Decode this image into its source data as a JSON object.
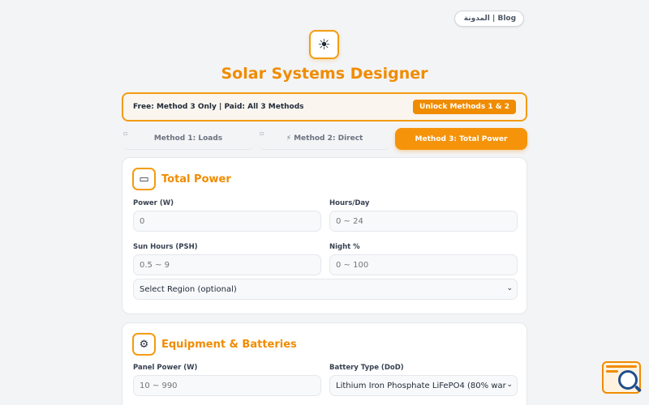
{
  "header": {
    "blog_link": " المدونة | Blog",
    "logo_icon": "sun-icon",
    "title": "Solar Systems Designer"
  },
  "promo": {
    "text": "Free: Method 3 Only | Paid: All 3 Methods",
    "button": "Unlock Methods 1 & 2"
  },
  "tabs": [
    {
      "label": "Method 1: Loads",
      "active": false
    },
    {
      "label": "⚡ Method 2: Direct",
      "active": false
    },
    {
      "label": "Method 3: Total Power",
      "active": true
    }
  ],
  "total_power": {
    "title": "Total Power",
    "icon": "plug-icon",
    "power_label": "Power (W)",
    "power_placeholder": "0",
    "hours_label": "Hours/Day",
    "hours_placeholder": "0 ~ 24",
    "sun_label": "Sun Hours (PSH)",
    "sun_placeholder": "0.5 ~ 9",
    "night_label": "Night %",
    "night_placeholder": "0 ~ 100",
    "region_select": "Select Region (optional)"
  },
  "equipment": {
    "title": "Equipment & Batteries",
    "icon": "gear-icon",
    "panel_label": "Panel Power (W)",
    "panel_placeholder": "10 ~ 990",
    "battery_label": "Battery Type (DoD)",
    "battery_value": "Lithium Iron Phosphate LiFePO4 (80% warr"
  },
  "colors": {
    "accent": "#f08c00",
    "border_accent": "#f39c12",
    "background": "#f3f4f6"
  }
}
